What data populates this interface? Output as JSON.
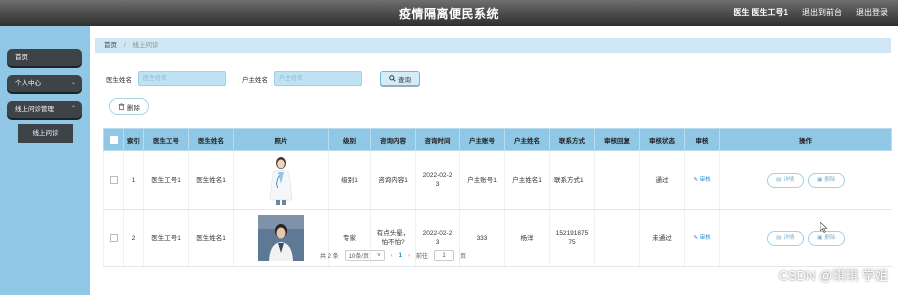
{
  "header": {
    "title": "疫情隔离便民系统",
    "user_label": "医生 医生工号1",
    "back_label": "退出到前台",
    "logout_label": "退出登录"
  },
  "sidebar": {
    "items": [
      {
        "label": "首页"
      },
      {
        "label": "个人中心"
      },
      {
        "label": "线上问诊管理"
      }
    ],
    "sub_item": "线上问诊"
  },
  "breadcrumb": {
    "home": "首页",
    "current": "线上问诊"
  },
  "search": {
    "doctor_name_label": "医生姓名",
    "doctor_name_placeholder": "医生姓名",
    "household_name_label": "户主姓名",
    "household_name_placeholder": "户主姓名",
    "search_button": "查询"
  },
  "toolbar": {
    "delete_button": "删除"
  },
  "table": {
    "headers": [
      "索引",
      "医生工号",
      "医生姓名",
      "照片",
      "级别",
      "咨询内容",
      "咨询时间",
      "户主账号",
      "户主姓名",
      "联系方式",
      "审核回复",
      "审核状态",
      "审核",
      "操作"
    ],
    "rows": [
      {
        "index": "1",
        "doctor_id": "医生工号1",
        "doctor_name": "医生姓名1",
        "level": "级别1",
        "content": "咨询内容1",
        "time": "2022-02-23",
        "account": "户主账号1",
        "name": "户主姓名1",
        "contact": "联系方式1",
        "reply": "",
        "status": "通过",
        "audit": "审核"
      },
      {
        "index": "2",
        "doctor_id": "医生工号1",
        "doctor_name": "医生姓名1",
        "level": "专家",
        "content": "有点头晕，怕不怕?",
        "time": "2022-02-23",
        "account": "333",
        "name": "杨洋",
        "contact": "15219187575",
        "reply": "",
        "status": "未通过",
        "audit": "审核"
      }
    ],
    "detail_button": "详情",
    "delete_button": "删除"
  },
  "pagination": {
    "total": "共 2 条",
    "page_size": "10条/页",
    "current_page": "1",
    "goto_label": "前往",
    "goto_value": "1",
    "page_unit": "页"
  },
  "watermark": "CSDN @琪琪 学姐"
}
